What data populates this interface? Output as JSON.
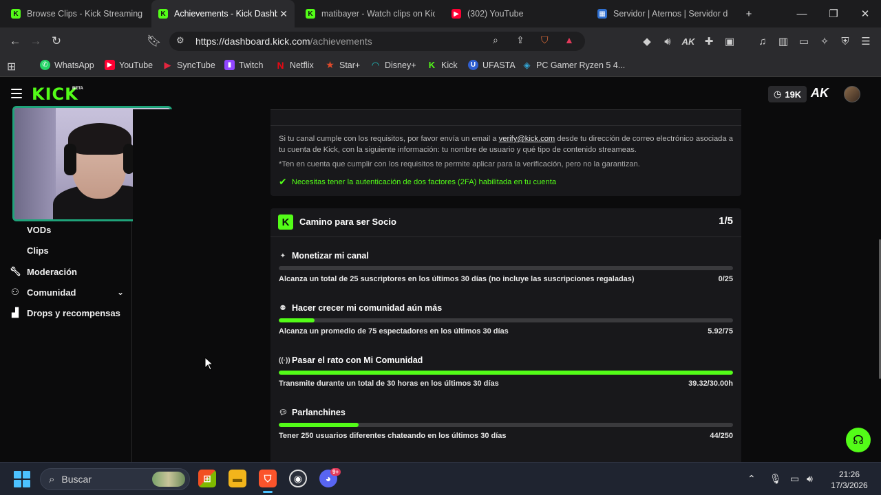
{
  "browser": {
    "tabs": [
      {
        "label": "Browse Clips - Kick Streaming",
        "icon": "kick-icon",
        "active": false
      },
      {
        "label": "Achievements - Kick Dashb",
        "icon": "kick-icon",
        "active": true
      },
      {
        "label": "matibayer - Watch clips on Kic",
        "icon": "kick-icon",
        "active": false
      },
      {
        "label": "(302) YouTube",
        "icon": "youtube-icon",
        "active": false
      },
      {
        "label": "Servidor | Aternos | Servidor de",
        "icon": "aternos-icon",
        "active": false
      }
    ],
    "new_tab": "+",
    "url_host": "https://dashboard.kick.com",
    "url_path": "/achievements",
    "bookmarks": [
      {
        "label": "WhatsApp",
        "icon": "whatsapp-icon",
        "color": "#25d366"
      },
      {
        "label": "YouTube",
        "icon": "youtube-icon",
        "color": "#ff0033"
      },
      {
        "label": "SyncTube",
        "icon": "synctube-icon",
        "color": "#e3263e"
      },
      {
        "label": "Twitch",
        "icon": "twitch-icon",
        "color": "#9146ff"
      },
      {
        "label": "Netflix",
        "icon": "netflix-icon",
        "color": "#e50914"
      },
      {
        "label": "Star+",
        "icon": "star-icon",
        "color": "#e04a2a"
      },
      {
        "label": "Disney+",
        "icon": "disney-icon",
        "color": "#1fc2c2"
      },
      {
        "label": "Kick",
        "icon": "kick-icon",
        "color": "#53fc18"
      },
      {
        "label": "UFASTA",
        "icon": "ufasta-icon",
        "color": "#2f5fd0"
      },
      {
        "label": "PC Gamer Ryzen 5 4...",
        "icon": "pc-icon",
        "color": "#33a6d6"
      }
    ]
  },
  "header": {
    "logo": "KICK",
    "beta": "BETA",
    "viewers": "19K"
  },
  "sidebar": {
    "items": [
      {
        "label": "VODs",
        "icon": ""
      },
      {
        "label": "Clips",
        "icon": ""
      },
      {
        "label": "Moderación",
        "icon": "wrench-icon"
      },
      {
        "label": "Comunidad",
        "icon": "community-icon"
      },
      {
        "label": "Drops y recompensas",
        "icon": "gift-icon"
      }
    ]
  },
  "requirements": {
    "text_before_email": "Si tu canal cumple con los requisitos, por favor envía un email a ",
    "email": "verify@kick.com",
    "text_after_email": " desde tu dirección de correo electrónico asociada a tu cuenta de Kick, con la siguiente información: tu nombre de usuario y qué tipo de contenido streameas.",
    "note": "*Ten en cuenta que cumplir con los requisitos te permite aplicar para la verificación, pero no la garantizan.",
    "twofa": "Necesitas tener la autenticación de dos factores (2FA) habilitada en tu cuenta"
  },
  "partner": {
    "badge": "K",
    "title": "Camino para ser Socio",
    "count": "1/5",
    "achievements": [
      {
        "title": "Monetizar mi canal",
        "icon": "sparkle-icon",
        "description": "Alcanza un total de 25 suscriptores en los últimos 30 días (no incluye las suscripciones regaladas)",
        "progress_text": "0/25",
        "progress": 0.0
      },
      {
        "title": "Hacer crecer mi comunidad aún más",
        "icon": "users-icon",
        "description": "Alcanza un promedio de 75 espectadores en los últimos 30 días",
        "progress_text": "5.92/75",
        "progress": 0.079
      },
      {
        "title": "Pasar el rato con Mi Comunidad",
        "icon": "broadcast-icon",
        "description": "Transmite durante un total de 30 horas en los últimos 30 días",
        "progress_text": "39.32/30.00h",
        "progress": 1.0
      },
      {
        "title": "Parlanchines",
        "icon": "chat-icon",
        "description": "Tener 250 usuarios diferentes chateando en los últimos 30 días",
        "progress_text": "44/250",
        "progress": 0.176
      }
    ]
  },
  "taskbar": {
    "search_label": "Buscar",
    "time": "21:26",
    "date": "17/3/2026",
    "discord_badge": "9+"
  },
  "colors": {
    "kick_green": "#53fc18",
    "card_bg": "#18181b",
    "page_bg": "#0b0b0c"
  }
}
